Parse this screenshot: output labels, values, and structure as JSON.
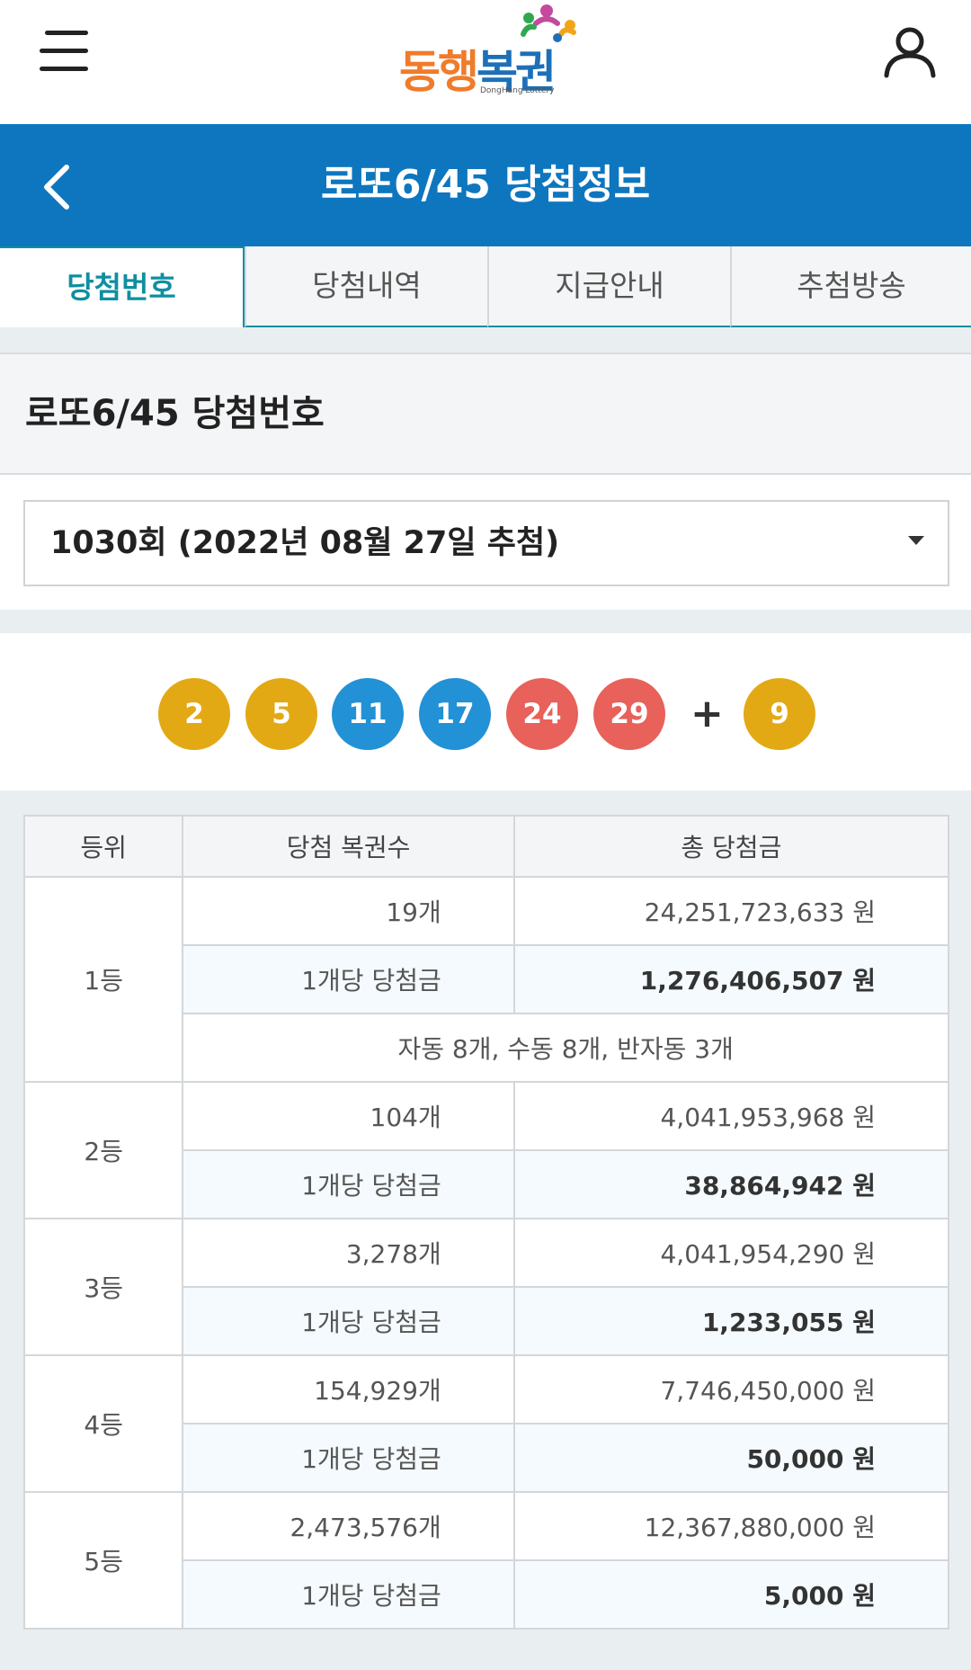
{
  "header": {
    "logo": {
      "chars": [
        "동",
        "행",
        "복",
        "권"
      ],
      "sub": "DongHang Lottery"
    }
  },
  "titlebar": {
    "title": "로또6/45 당첨정보"
  },
  "tabs": [
    {
      "label": "당첨번호",
      "active": true
    },
    {
      "label": "당첨내역",
      "active": false
    },
    {
      "label": "지급안내",
      "active": false
    },
    {
      "label": "추첨방송",
      "active": false
    }
  ],
  "section": {
    "title": "로또6/45 당첨번호"
  },
  "draw_select": {
    "value": "1030회 (2022년 08월 27일 추첨)"
  },
  "balls": [
    {
      "number": "2",
      "color": "#e3a914"
    },
    {
      "number": "5",
      "color": "#e3a914"
    },
    {
      "number": "11",
      "color": "#2291d6"
    },
    {
      "number": "17",
      "color": "#2291d6"
    },
    {
      "number": "24",
      "color": "#e8615a"
    },
    {
      "number": "29",
      "color": "#e8615a"
    }
  ],
  "plus": "+",
  "bonus": {
    "number": "9",
    "color": "#e3a914"
  },
  "table": {
    "headers": [
      "등위",
      "당첨 복권수",
      "총 당첨금"
    ],
    "ranks": [
      {
        "rank": "1등",
        "count": "19개",
        "total": "24,251,723,633 원",
        "per_label": "1개당 당첨금",
        "per_amount": "1,276,406,507 원",
        "note": "자동 8개, 수동 8개, 반자동 3개"
      },
      {
        "rank": "2등",
        "count": "104개",
        "total": "4,041,953,968 원",
        "per_label": "1개당 당첨금",
        "per_amount": "38,864,942 원"
      },
      {
        "rank": "3등",
        "count": "3,278개",
        "total": "4,041,954,290 원",
        "per_label": "1개당 당첨금",
        "per_amount": "1,233,055 원"
      },
      {
        "rank": "4등",
        "count": "154,929개",
        "total": "7,746,450,000 원",
        "per_label": "1개당 당첨금",
        "per_amount": "50,000 원"
      },
      {
        "rank": "5등",
        "count": "2,473,576개",
        "total": "12,367,880,000 원",
        "per_label": "1개당 당첨금",
        "per_amount": "5,000 원"
      }
    ]
  }
}
